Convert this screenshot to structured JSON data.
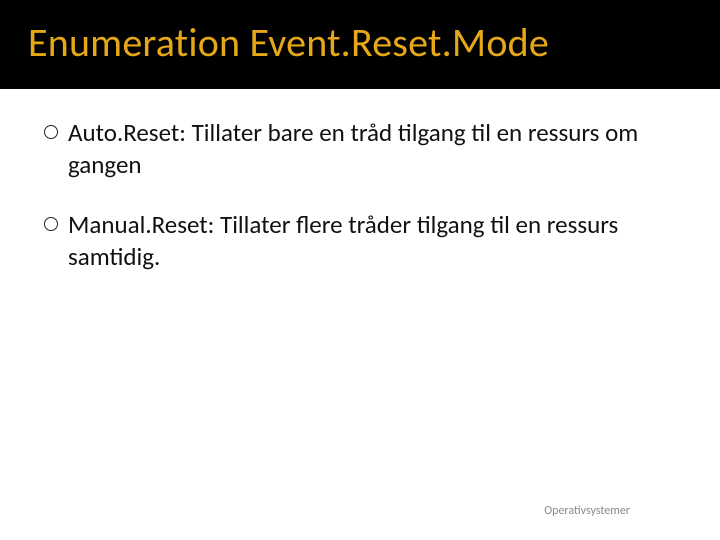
{
  "title": "Enumeration Event.Reset.Mode",
  "bullets": [
    "Auto.Reset: Tillater bare en tråd tilgang til en ressurs om gangen",
    "Manual.Reset: Tillater flere tråder tilgang til en ressurs samtidig."
  ],
  "footer": "Operativsystemer"
}
